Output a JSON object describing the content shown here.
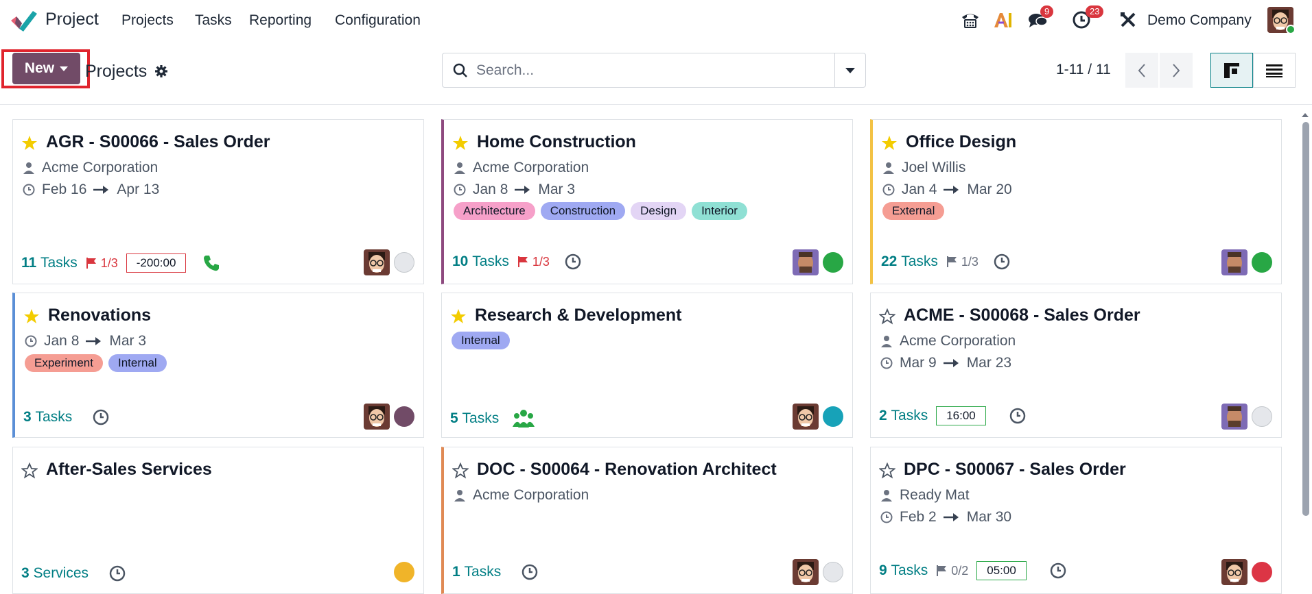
{
  "nav": {
    "app_name": "Project",
    "menu": [
      "Projects",
      "Tasks",
      "Reporting",
      "Configuration"
    ],
    "messages_badge": "9",
    "activities_badge": "23",
    "company": "Demo Company"
  },
  "control": {
    "new_label": "New",
    "title": "Projects",
    "search_placeholder": "Search...",
    "pager": "1-11 / 11"
  },
  "colors": {
    "brand": "#714b67",
    "teal": "#017e84",
    "star": "#f3cc00",
    "highlight": "#e0242d"
  },
  "cards": [
    {
      "title": "AGR - S00066 - Sales Order",
      "starred": true,
      "customer": "Acme Corporation",
      "dates": {
        "start": "Feb 16",
        "end": "Apr 13"
      },
      "tags": [],
      "tasks_count": "11",
      "tasks_word": "Tasks",
      "milestone": "1/3",
      "hours": "-200:00",
      "status": "grey"
    },
    {
      "title": "Home Construction",
      "starred": true,
      "customer": "Acme Corporation",
      "dates": {
        "start": "Jan 8",
        "end": "Mar 3"
      },
      "tags": [
        "Architecture",
        "Construction",
        "Design",
        "Interior"
      ],
      "tasks_count": "10",
      "tasks_word": "Tasks",
      "milestone": "1/3",
      "status": "green"
    },
    {
      "title": "Office Design",
      "starred": true,
      "customer": "Joel Willis",
      "dates": {
        "start": "Jan 4",
        "end": "Mar 20"
      },
      "tags": [
        "External"
      ],
      "tasks_count": "22",
      "tasks_word": "Tasks",
      "milestone": "1/3",
      "status": "green"
    },
    {
      "title": "Renovations",
      "starred": true,
      "dates": {
        "start": "Jan 8",
        "end": "Mar 3"
      },
      "tags": [
        "Experiment",
        "Internal"
      ],
      "tasks_count": "3",
      "tasks_word": "Tasks",
      "status": "purple"
    },
    {
      "title": "Research & Development",
      "starred": true,
      "tags": [
        "Internal"
      ],
      "tasks_count": "5",
      "tasks_word": "Tasks",
      "status": "teal"
    },
    {
      "title": "ACME - S00068 - Sales Order",
      "starred": false,
      "customer": "Acme Corporation",
      "dates": {
        "start": "Mar 9",
        "end": "Mar 23"
      },
      "tags": [],
      "tasks_count": "2",
      "tasks_word": "Tasks",
      "hours": "16:00",
      "status": "grey"
    },
    {
      "title": "After-Sales Services",
      "starred": false,
      "tags": [],
      "tasks_count": "3",
      "tasks_word": "Services",
      "status": "yellow"
    },
    {
      "title": "DOC - S00064 - Renovation Architect",
      "starred": false,
      "customer": "Acme Corporation",
      "tags": [],
      "tasks_count": "1",
      "tasks_word": "Tasks",
      "status": "grey"
    },
    {
      "title": "DPC - S00067 - Sales Order",
      "starred": false,
      "customer": "Ready Mat",
      "dates": {
        "start": "Feb 2",
        "end": "Mar 30"
      },
      "tags": [],
      "tasks_count": "9",
      "tasks_word": "Tasks",
      "milestone": "0/2",
      "hours": "05:00",
      "status": "red"
    }
  ]
}
